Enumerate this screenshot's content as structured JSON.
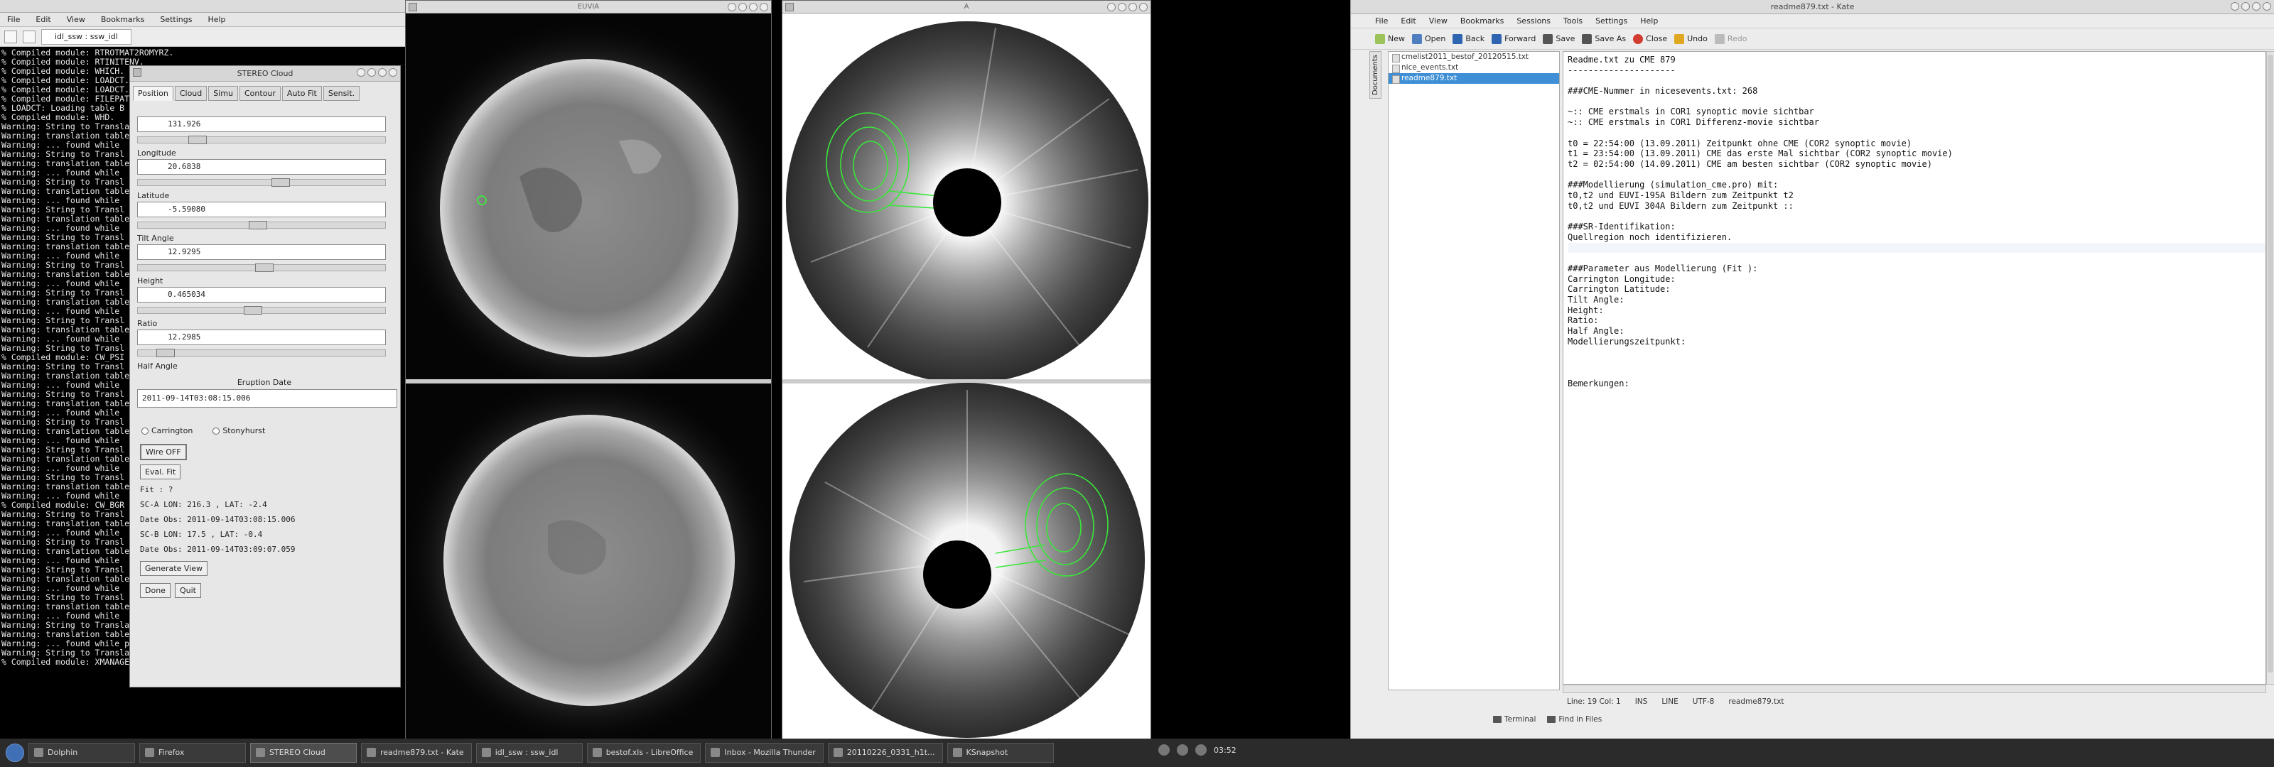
{
  "terminal": {
    "menu": [
      "File",
      "Edit",
      "View",
      "Bookmarks",
      "Settings",
      "Help"
    ],
    "tab_title": "idl_ssw : ssw_idl",
    "lines": [
      "% Compiled module: RTROTMAT2ROMYRZ.",
      "% Compiled module: RTINITENV.",
      "% Compiled module: WHICH.",
      "% Compiled module: LOADCT.",
      "% Compiled module: LOADCT.",
      "% Compiled module: FILEPATH.",
      "% LOADCT: Loading table B",
      "% Compiled module: WHD.",
      "Warning: String to Translation",
      "Warning: translation table",
      "Warning: ... found while",
      "Warning: String to Transl",
      "Warning: translation table",
      "Warning: ... found while",
      "Warning: String to Transl",
      "Warning: translation table",
      "Warning: ... found while",
      "Warning: String to Transl",
      "Warning: translation table",
      "Warning: ... found while",
      "Warning: String to Transl",
      "Warning: translation table",
      "Warning: ... found while",
      "Warning: String to Transl",
      "Warning: translation table",
      "Warning: ... found while",
      "Warning: String to Transl",
      "Warning: translation table",
      "Warning: ... found while",
      "Warning: String to Transl",
      "Warning: translation table",
      "Warning: ... found while",
      "Warning: String to Transl",
      "% Compiled module: CW_PSI",
      "Warning: String to Transl",
      "Warning: translation table",
      "Warning: ... found while",
      "Warning: String to Transl",
      "Warning: translation table",
      "Warning: ... found while",
      "Warning: String to Transl",
      "Warning: translation table",
      "Warning: ... found while",
      "Warning: String to Transl",
      "Warning: translation table",
      "Warning: ... found while",
      "Warning: String to Transl",
      "Warning: translation table",
      "Warning: ... found while",
      "% Compiled module: CW_BGR",
      "Warning: String to Transl",
      "Warning: translation table",
      "Warning: ... found while",
      "Warning: String to Transl",
      "Warning: translation table",
      "Warning: ... found while",
      "Warning: String to Transl",
      "Warning: translation table",
      "Warning: ... found while",
      "Warning: String to Transl",
      "Warning: translation table",
      "Warning: ... found while",
      "Warning: String to TranslationTable conversion encountered errors",
      "Warning: translation table syntax error: Unknown keysym name:  osfSelect",
      "Warning: ... found while parsing '<Key>osfSelect:         ArmAndActivate()'",
      "Warning: String to TranslationTable conversion encountered errors",
      "% Compiled module: XMANAGER."
    ]
  },
  "cloud": {
    "title": "STEREO Cloud",
    "tabs": [
      "Position",
      "Cloud",
      "Simu",
      "Contour",
      "Auto Fit",
      "Sensit."
    ],
    "params": [
      {
        "label": "",
        "value": "131.926",
        "slider": 0.22
      },
      {
        "label": "Longitude",
        "value": "20.6838",
        "slider": 0.58
      },
      {
        "label": "Latitude",
        "value": "-5.59080",
        "slider": 0.48
      },
      {
        "label": "Tilt Angle",
        "value": "12.9295",
        "slider": 0.51
      },
      {
        "label": "Height",
        "value": "0.465034",
        "slider": 0.46
      },
      {
        "label": "Ratio",
        "value": "12.2985",
        "slider": 0.08
      }
    ],
    "half_angle_label": "Half Angle",
    "eruption_label": "Eruption Date",
    "eruption_value": "2011-09-14T03:08:15.006",
    "coord_carrington": "Carrington",
    "coord_stonyhurst": "Stonyhurst",
    "wire_button": "Wire OFF",
    "eval_button": "Eval. Fit",
    "fit_text": "Fit : ?",
    "sca_line": "SC-A LON:   216.3 , LAT:  -2.4",
    "date_obs_a": "Date Obs: 2011-09-14T03:08:15.006",
    "scb_line": "SC-B LON:    17.5 , LAT:  -0.4",
    "date_obs_b": "Date Obs: 2011-09-14T03:09:07.059",
    "generate_button": "Generate View",
    "done_button": "Done",
    "quit_button": "Quit"
  },
  "imgwin_left": {
    "title": "EUVIA"
  },
  "imgwin_right": {
    "title": "A"
  },
  "kate": {
    "title": "readme879.txt - Kate",
    "menu": [
      "File",
      "Edit",
      "View",
      "Bookmarks",
      "Sessions",
      "Tools",
      "Settings",
      "Help"
    ],
    "toolbar": [
      "New",
      "Open",
      "Back",
      "Forward",
      "Save",
      "Save As",
      "Close",
      "Undo",
      "Redo"
    ],
    "sidetabs": [
      "Documents"
    ],
    "documents": [
      "cmelist2011_bestof_20120515.txt",
      "nice_events.txt",
      "readme879.txt"
    ],
    "active_doc": 2,
    "lines": [
      "Readme.txt zu CME 879",
      "---------------------",
      "",
      "###CME-Nummer in nicesevents.txt: 268",
      "",
      "~:: CME erstmals in COR1 synoptic movie sichtbar",
      "~:: CME erstmals in COR1 Differenz-movie sichtbar",
      "",
      "t0 = 22:54:00 (13.09.2011) Zeitpunkt ohne CME (COR2 synoptic movie)",
      "t1 = 23:54:00 (13.09.2011) CME das erste Mal sichtbar (COR2 synoptic movie)",
      "t2 = 02:54:00 (14.09.2011) CME am besten sichtbar (COR2 synoptic movie)",
      "",
      "###Modellierung (simulation_cme.pro) mit:",
      "t0,t2 und EUVI-195A Bildern zum Zeitpunkt t2",
      "t0,t2 und EUVI 304A Bildern zum Zeitpunkt ::",
      "",
      "###SR-Identifikation:",
      "Quellregion noch identifizieren.",
      "",
      "",
      "###Parameter aus Modellierung (Fit ):",
      "Carrington Longitude:",
      "Carrington Latitude:",
      "Tilt Angle:",
      "Height:",
      "Ratio:",
      "Half Angle:",
      "Modellierungszeitpunkt:",
      "",
      "",
      "",
      "Bemerkungen:"
    ],
    "status": [
      "Line: 19 Col: 1",
      "INS",
      "LINE",
      "UTF-8",
      "readme879.txt"
    ],
    "bottom": [
      "Terminal",
      "Find in Files"
    ]
  },
  "taskbar": {
    "tasks": [
      "Dolphin",
      "Firefox",
      "STEREO Cloud",
      "readme879.txt - Kate",
      "idl_ssw : ssw_idl",
      "bestof.xls - LibreOffice",
      "Inbox - Mozilla Thunder",
      "20110226_0331_h1t...",
      "KSnapshot"
    ],
    "active_task": 2,
    "clock": "03:52"
  }
}
